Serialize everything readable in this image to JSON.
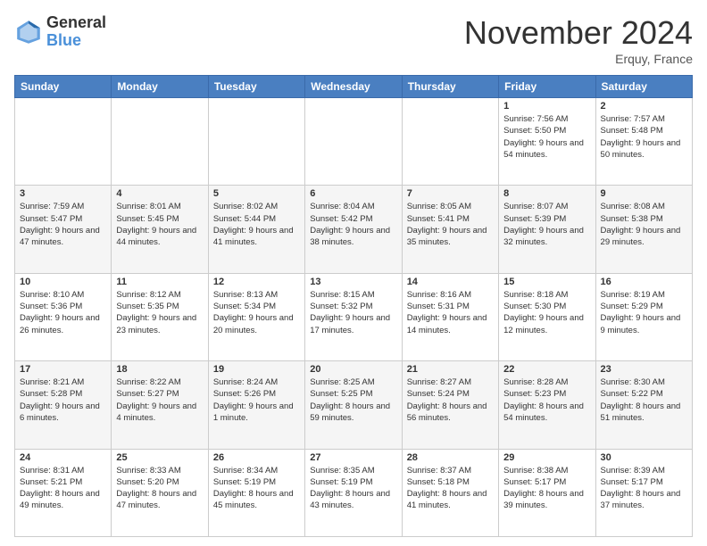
{
  "header": {
    "logo_general": "General",
    "logo_blue": "Blue",
    "month_title": "November 2024",
    "location": "Erquy, France"
  },
  "days_of_week": [
    "Sunday",
    "Monday",
    "Tuesday",
    "Wednesday",
    "Thursday",
    "Friday",
    "Saturday"
  ],
  "weeks": [
    [
      {
        "day": "",
        "info": ""
      },
      {
        "day": "",
        "info": ""
      },
      {
        "day": "",
        "info": ""
      },
      {
        "day": "",
        "info": ""
      },
      {
        "day": "",
        "info": ""
      },
      {
        "day": "1",
        "info": "Sunrise: 7:56 AM\nSunset: 5:50 PM\nDaylight: 9 hours and 54 minutes."
      },
      {
        "day": "2",
        "info": "Sunrise: 7:57 AM\nSunset: 5:48 PM\nDaylight: 9 hours and 50 minutes."
      }
    ],
    [
      {
        "day": "3",
        "info": "Sunrise: 7:59 AM\nSunset: 5:47 PM\nDaylight: 9 hours and 47 minutes."
      },
      {
        "day": "4",
        "info": "Sunrise: 8:01 AM\nSunset: 5:45 PM\nDaylight: 9 hours and 44 minutes."
      },
      {
        "day": "5",
        "info": "Sunrise: 8:02 AM\nSunset: 5:44 PM\nDaylight: 9 hours and 41 minutes."
      },
      {
        "day": "6",
        "info": "Sunrise: 8:04 AM\nSunset: 5:42 PM\nDaylight: 9 hours and 38 minutes."
      },
      {
        "day": "7",
        "info": "Sunrise: 8:05 AM\nSunset: 5:41 PM\nDaylight: 9 hours and 35 minutes."
      },
      {
        "day": "8",
        "info": "Sunrise: 8:07 AM\nSunset: 5:39 PM\nDaylight: 9 hours and 32 minutes."
      },
      {
        "day": "9",
        "info": "Sunrise: 8:08 AM\nSunset: 5:38 PM\nDaylight: 9 hours and 29 minutes."
      }
    ],
    [
      {
        "day": "10",
        "info": "Sunrise: 8:10 AM\nSunset: 5:36 PM\nDaylight: 9 hours and 26 minutes."
      },
      {
        "day": "11",
        "info": "Sunrise: 8:12 AM\nSunset: 5:35 PM\nDaylight: 9 hours and 23 minutes."
      },
      {
        "day": "12",
        "info": "Sunrise: 8:13 AM\nSunset: 5:34 PM\nDaylight: 9 hours and 20 minutes."
      },
      {
        "day": "13",
        "info": "Sunrise: 8:15 AM\nSunset: 5:32 PM\nDaylight: 9 hours and 17 minutes."
      },
      {
        "day": "14",
        "info": "Sunrise: 8:16 AM\nSunset: 5:31 PM\nDaylight: 9 hours and 14 minutes."
      },
      {
        "day": "15",
        "info": "Sunrise: 8:18 AM\nSunset: 5:30 PM\nDaylight: 9 hours and 12 minutes."
      },
      {
        "day": "16",
        "info": "Sunrise: 8:19 AM\nSunset: 5:29 PM\nDaylight: 9 hours and 9 minutes."
      }
    ],
    [
      {
        "day": "17",
        "info": "Sunrise: 8:21 AM\nSunset: 5:28 PM\nDaylight: 9 hours and 6 minutes."
      },
      {
        "day": "18",
        "info": "Sunrise: 8:22 AM\nSunset: 5:27 PM\nDaylight: 9 hours and 4 minutes."
      },
      {
        "day": "19",
        "info": "Sunrise: 8:24 AM\nSunset: 5:26 PM\nDaylight: 9 hours and 1 minute."
      },
      {
        "day": "20",
        "info": "Sunrise: 8:25 AM\nSunset: 5:25 PM\nDaylight: 8 hours and 59 minutes."
      },
      {
        "day": "21",
        "info": "Sunrise: 8:27 AM\nSunset: 5:24 PM\nDaylight: 8 hours and 56 minutes."
      },
      {
        "day": "22",
        "info": "Sunrise: 8:28 AM\nSunset: 5:23 PM\nDaylight: 8 hours and 54 minutes."
      },
      {
        "day": "23",
        "info": "Sunrise: 8:30 AM\nSunset: 5:22 PM\nDaylight: 8 hours and 51 minutes."
      }
    ],
    [
      {
        "day": "24",
        "info": "Sunrise: 8:31 AM\nSunset: 5:21 PM\nDaylight: 8 hours and 49 minutes."
      },
      {
        "day": "25",
        "info": "Sunrise: 8:33 AM\nSunset: 5:20 PM\nDaylight: 8 hours and 47 minutes."
      },
      {
        "day": "26",
        "info": "Sunrise: 8:34 AM\nSunset: 5:19 PM\nDaylight: 8 hours and 45 minutes."
      },
      {
        "day": "27",
        "info": "Sunrise: 8:35 AM\nSunset: 5:19 PM\nDaylight: 8 hours and 43 minutes."
      },
      {
        "day": "28",
        "info": "Sunrise: 8:37 AM\nSunset: 5:18 PM\nDaylight: 8 hours and 41 minutes."
      },
      {
        "day": "29",
        "info": "Sunrise: 8:38 AM\nSunset: 5:17 PM\nDaylight: 8 hours and 39 minutes."
      },
      {
        "day": "30",
        "info": "Sunrise: 8:39 AM\nSunset: 5:17 PM\nDaylight: 8 hours and 37 minutes."
      }
    ]
  ]
}
